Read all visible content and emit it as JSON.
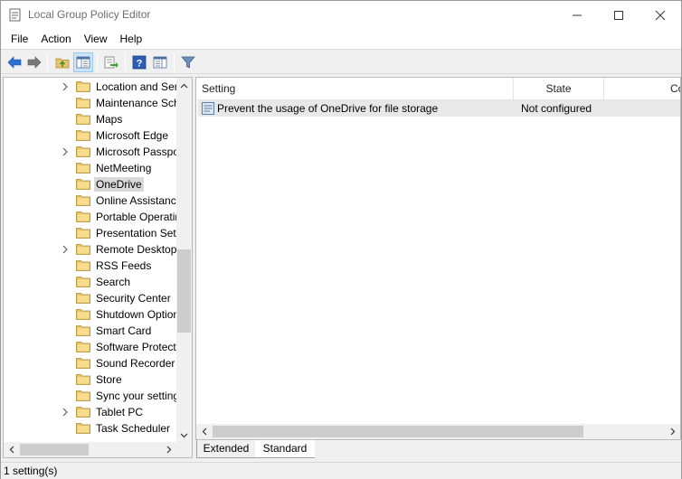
{
  "window": {
    "title": "Local Group Policy Editor",
    "app_icon": "group-policy-icon",
    "controls": [
      "minimize-icon",
      "maximize-icon",
      "close-icon"
    ]
  },
  "menubar": {
    "items": [
      {
        "label": "File"
      },
      {
        "label": "Action"
      },
      {
        "label": "View"
      },
      {
        "label": "Help"
      }
    ]
  },
  "toolbar": {
    "buttons": [
      {
        "icon": "back-arrow-icon"
      },
      {
        "icon": "forward-arrow-icon"
      },
      {
        "icon": "up-folder-icon"
      },
      {
        "icon": "show-hide-tree-icon",
        "pressed": true
      },
      {
        "icon": "export-list-icon"
      },
      {
        "icon": "help-icon"
      },
      {
        "icon": "properties-pane-icon"
      },
      {
        "icon": "filter-icon"
      }
    ]
  },
  "tree": {
    "items": [
      {
        "label": "Location and Sen",
        "expandable": true
      },
      {
        "label": "Maintenance Sch",
        "expandable": false
      },
      {
        "label": "Maps",
        "expandable": false
      },
      {
        "label": "Microsoft Edge",
        "expandable": false
      },
      {
        "label": "Microsoft Passpo",
        "expandable": true
      },
      {
        "label": "NetMeeting",
        "expandable": false
      },
      {
        "label": "OneDrive",
        "expandable": false,
        "selected": true
      },
      {
        "label": "Online Assistance",
        "expandable": false
      },
      {
        "label": "Portable Operatin",
        "expandable": false
      },
      {
        "label": "Presentation Sett",
        "expandable": false
      },
      {
        "label": "Remote Desktop",
        "expandable": true
      },
      {
        "label": "RSS Feeds",
        "expandable": false
      },
      {
        "label": "Search",
        "expandable": false
      },
      {
        "label": "Security Center",
        "expandable": false
      },
      {
        "label": "Shutdown Option",
        "expandable": false
      },
      {
        "label": "Smart Card",
        "expandable": false
      },
      {
        "label": "Software Protecti",
        "expandable": false
      },
      {
        "label": "Sound Recorder",
        "expandable": false
      },
      {
        "label": "Store",
        "expandable": false
      },
      {
        "label": "Sync your setting",
        "expandable": false
      },
      {
        "label": "Tablet PC",
        "expandable": true
      },
      {
        "label": "Task Scheduler",
        "expandable": false
      }
    ]
  },
  "list": {
    "columns": [
      "Setting",
      "State",
      "Co"
    ],
    "rows": [
      {
        "setting": "Prevent the usage of OneDrive for file storage",
        "state": "Not configured",
        "icon": "policy-setting-icon"
      }
    ]
  },
  "tabs": [
    {
      "label": "Extended",
      "active": false
    },
    {
      "label": "Standard",
      "active": true
    }
  ],
  "status": {
    "text": "1 setting(s)"
  },
  "colors": {
    "selection": "#d9d9d9",
    "row_highlight": "#e8e8e8",
    "folder": "#e8c36a",
    "accent_blue": "#2b6fd1"
  }
}
